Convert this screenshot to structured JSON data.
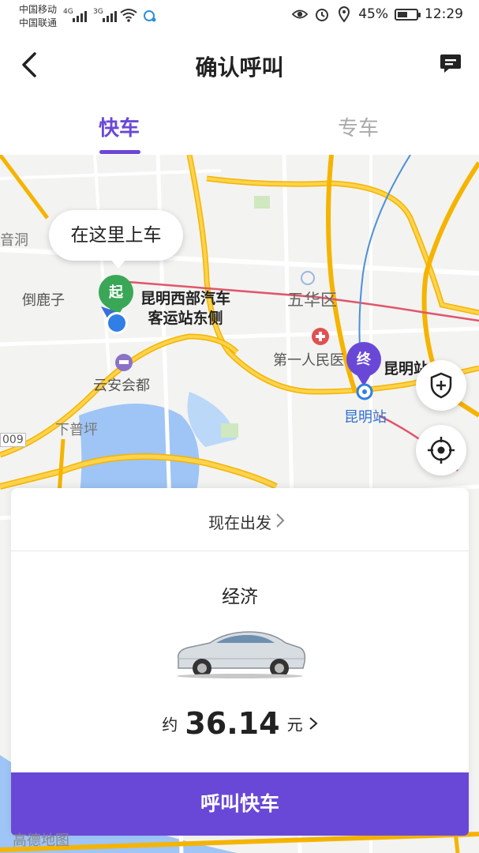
{
  "status": {
    "carrier1": "中国移动",
    "carrier2": "中国联通",
    "net1": "4G",
    "net2": "3G",
    "battery": "45%",
    "time": "12:29"
  },
  "header": {
    "title": "确认呼叫"
  },
  "tabs": [
    {
      "label": "快车",
      "active": true
    },
    {
      "label": "专车",
      "active": false
    }
  ],
  "map": {
    "pickup_bubble": "在这里上车",
    "start_badge": "起",
    "start_name_line1": "昆明西部汽车",
    "start_name_line2": "客运站东侧",
    "end_badge": "终",
    "end_name": "昆明站",
    "labels": {
      "daoluzi": "倒鹿子",
      "wuhuaqu": "五华区",
      "hospital": "第一人民医",
      "yunan": "云安会都",
      "xiapuping": "下普坪",
      "kunming_station": "昆明站",
      "yinyuedong": "音洞",
      "road009": "009"
    },
    "logo": "高德地图"
  },
  "sheet": {
    "depart_label": "现在出发",
    "car_type": "经济",
    "price_prefix": "约",
    "price_value": "36.14",
    "price_unit": "元",
    "call_button": "呼叫快车"
  },
  "colors": {
    "accent": "#6a48d7",
    "start_green": "#3aa757",
    "end_purple": "#6a48d7",
    "road_yellow": "#f7c531",
    "water": "#9ec5f5"
  },
  "icons": {
    "back": "back-arrow-icon",
    "message": "message-icon",
    "safety": "shield-plus-icon",
    "locate": "locate-icon"
  }
}
